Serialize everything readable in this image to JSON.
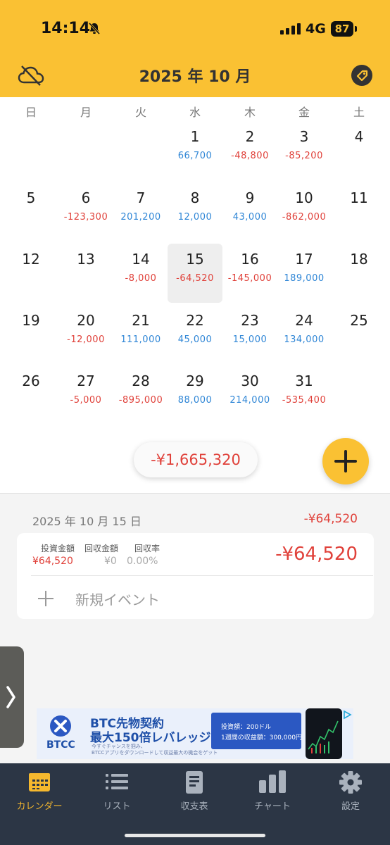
{
  "status_bar": {
    "time": "14:14",
    "network": "4G",
    "battery": "87"
  },
  "header": {
    "title": "2025 年 10 月"
  },
  "weekdays": [
    "日",
    "月",
    "火",
    "水",
    "木",
    "金",
    "土"
  ],
  "calendar": {
    "days": [
      {
        "day": "1",
        "amount": "66,700",
        "sign": "pos"
      },
      {
        "day": "2",
        "amount": "-48,800",
        "sign": "neg"
      },
      {
        "day": "3",
        "amount": "-85,200",
        "sign": "neg"
      },
      {
        "day": "4",
        "amount": "",
        "sign": ""
      },
      {
        "day": "5",
        "amount": "",
        "sign": ""
      },
      {
        "day": "6",
        "amount": "-123,300",
        "sign": "neg"
      },
      {
        "day": "7",
        "amount": "201,200",
        "sign": "pos"
      },
      {
        "day": "8",
        "amount": "12,000",
        "sign": "pos"
      },
      {
        "day": "9",
        "amount": "43,000",
        "sign": "pos"
      },
      {
        "day": "10",
        "amount": "-862,000",
        "sign": "neg"
      },
      {
        "day": "11",
        "amount": "",
        "sign": ""
      },
      {
        "day": "12",
        "amount": "",
        "sign": ""
      },
      {
        "day": "13",
        "amount": "",
        "sign": ""
      },
      {
        "day": "14",
        "amount": "-8,000",
        "sign": "neg"
      },
      {
        "day": "15",
        "amount": "-64,520",
        "sign": "neg",
        "selected": true
      },
      {
        "day": "16",
        "amount": "-145,000",
        "sign": "neg"
      },
      {
        "day": "17",
        "amount": "189,000",
        "sign": "pos"
      },
      {
        "day": "18",
        "amount": "",
        "sign": ""
      },
      {
        "day": "19",
        "amount": "",
        "sign": ""
      },
      {
        "day": "20",
        "amount": "-12,000",
        "sign": "neg"
      },
      {
        "day": "21",
        "amount": "111,000",
        "sign": "pos"
      },
      {
        "day": "22",
        "amount": "45,000",
        "sign": "pos"
      },
      {
        "day": "23",
        "amount": "15,000",
        "sign": "pos"
      },
      {
        "day": "24",
        "amount": "134,000",
        "sign": "pos"
      },
      {
        "day": "25",
        "amount": "",
        "sign": ""
      },
      {
        "day": "26",
        "amount": "",
        "sign": ""
      },
      {
        "day": "27",
        "amount": "-5,000",
        "sign": "neg"
      },
      {
        "day": "28",
        "amount": "-895,000",
        "sign": "neg"
      },
      {
        "day": "29",
        "amount": "88,000",
        "sign": "pos"
      },
      {
        "day": "30",
        "amount": "214,000",
        "sign": "pos"
      },
      {
        "day": "31",
        "amount": "-535,400",
        "sign": "neg"
      }
    ]
  },
  "monthly_total": "-¥1,665,320",
  "detail": {
    "date": "2025 年 10 月 15 日",
    "total": "-¥64,520",
    "stats": [
      {
        "label": "投資金額",
        "value": "¥64,520",
        "color": "neg"
      },
      {
        "label": "回収金額",
        "value": "¥0",
        "color": "muted"
      },
      {
        "label": "回収率",
        "value": "0.00%",
        "color": "muted"
      }
    ],
    "amount": "-¥64,520",
    "new_event": "新規イベント"
  },
  "ad": {
    "logo": "BTCC",
    "headline1": "BTC先物契約",
    "headline2": "最大150倍レバレッジ",
    "sub1": "今すぐチャンスを掴み、",
    "sub2": "BTCCアプリをダウンロードして収益最大の機会をゲット",
    "line1": "投資額：200ドル",
    "line2": "1週間の収益額：300,000円"
  },
  "tabs": [
    {
      "label": "カレンダー",
      "icon": "calendar-icon",
      "active": true
    },
    {
      "label": "リスト",
      "icon": "list-icon",
      "active": false
    },
    {
      "label": "収支表",
      "icon": "document-icon",
      "active": false
    },
    {
      "label": "チャート",
      "icon": "bar-chart-icon",
      "active": false
    },
    {
      "label": "設定",
      "icon": "gear-icon",
      "active": false
    }
  ],
  "colors": {
    "accent": "#fac133",
    "negative": "#e0413a",
    "positive": "#2f86d6",
    "tabbar": "#2c3645"
  }
}
